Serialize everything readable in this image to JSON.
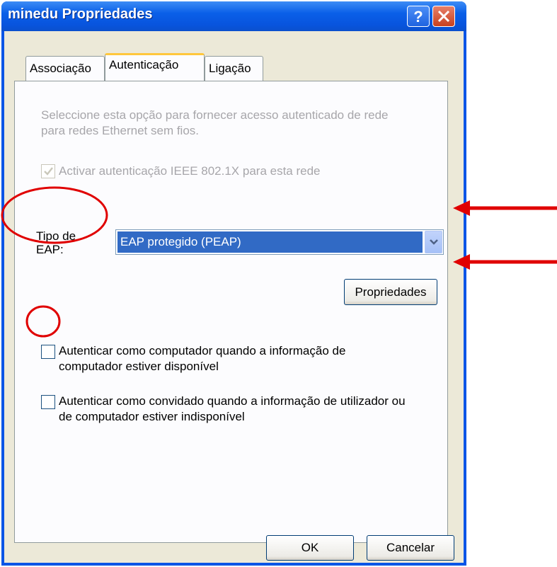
{
  "window": {
    "title": "minedu Propriedades"
  },
  "tabs": [
    {
      "label": "Associação",
      "selected": false
    },
    {
      "label": "Autenticação",
      "selected": true
    },
    {
      "label": "Ligação",
      "selected": false
    }
  ],
  "auth": {
    "description": [
      "Seleccione esta opção para fornecer acesso autenticado de rede",
      "para redes Ethernet sem fios."
    ],
    "enable_8021x": {
      "label": "Activar autenticação IEEE 802.1X para esta rede",
      "checked": true,
      "disabled": true
    },
    "eap_type": {
      "label": [
        "Tipo de",
        "EAP:"
      ],
      "selected": "EAP protegido (PEAP)"
    },
    "properties_button": "Propriedades",
    "auth_as_computer": {
      "label": [
        "Autenticar como computador quando a informação de",
        "computador estiver disponível"
      ],
      "checked": false
    },
    "auth_as_guest": {
      "label": [
        "Autenticar como convidado quando a informação de utilizador ou",
        "de computador estiver indisponível"
      ],
      "checked": false
    }
  },
  "footer": {
    "ok": "OK",
    "cancel": "Cancelar"
  },
  "colors": {
    "titlebar": "#0a55e6",
    "selection": "#316ac5",
    "annotation": "#e00000",
    "tab_highlight": "#ffc73c"
  }
}
